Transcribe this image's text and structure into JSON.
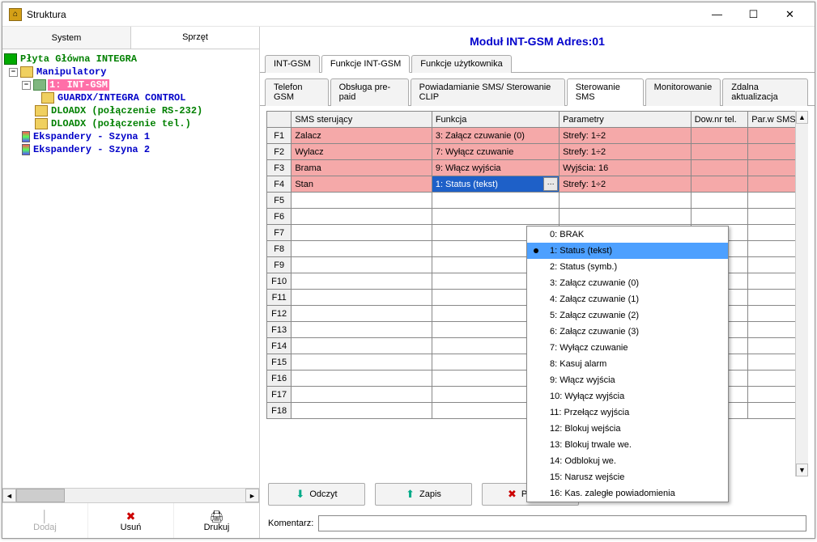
{
  "window": {
    "title": "Struktura"
  },
  "leftTabs": {
    "system": "System",
    "sprzet": "Sprzęt"
  },
  "tree": {
    "root": "Płyta Główna INTEGRA",
    "manip": "Manipulatory",
    "intgsm": "1: INT-GSM",
    "guardx": "GUARDX/INTEGRA CONTROL",
    "dload1": "DLOADX (połączenie RS-232)",
    "dload2": "DLOADX (połączenie tel.)",
    "exp1": "Ekspandery - Szyna 1",
    "exp2": "Ekspandery - Szyna 2"
  },
  "bottomBtns": {
    "dodaj": "Dodaj",
    "usun": "Usuń",
    "drukuj": "Drukuj"
  },
  "module": {
    "title": "Moduł INT-GSM Adres:01"
  },
  "mainTabs": {
    "t1": "INT-GSM",
    "t2": "Funkcje INT-GSM",
    "t3": "Funkcje użytkownika"
  },
  "subTabs": {
    "s1": "Telefon GSM",
    "s2": "Obsługa pre-paid",
    "s3": "Powiadamianie SMS/ Sterowanie CLIP",
    "s4": "Sterowanie SMS",
    "s5": "Monitorowanie",
    "s6": "Zdalna aktualizacja"
  },
  "cols": {
    "c0": "",
    "c1": "SMS sterujący",
    "c2": "Funkcja",
    "c3": "Parametry",
    "c4": "Dow.nr tel.",
    "c5": "Par.w SMS"
  },
  "rows": [
    {
      "id": "F1",
      "sms": "Zalacz",
      "func": "3: Załącz czuwanie (0)",
      "param": "Strefy: 1÷2",
      "pink": true
    },
    {
      "id": "F2",
      "sms": "Wylacz",
      "func": "7: Wyłącz czuwanie",
      "param": "Strefy: 1÷2",
      "pink": true
    },
    {
      "id": "F3",
      "sms": "Brama",
      "func": "9: Włącz wyjścia",
      "param": "Wyjścia: 16",
      "pink": true
    },
    {
      "id": "F4",
      "sms": "Stan",
      "func": "1: Status (tekst)",
      "param": "Strefy: 1÷2",
      "pink": true,
      "sel": true
    },
    {
      "id": "F5"
    },
    {
      "id": "F6"
    },
    {
      "id": "F7"
    },
    {
      "id": "F8"
    },
    {
      "id": "F9"
    },
    {
      "id": "F10"
    },
    {
      "id": "F11"
    },
    {
      "id": "F12"
    },
    {
      "id": "F13"
    },
    {
      "id": "F14"
    },
    {
      "id": "F15"
    },
    {
      "id": "F16"
    },
    {
      "id": "F17"
    },
    {
      "id": "F18"
    }
  ],
  "dropdown": [
    "0: BRAK",
    "1: Status (tekst)",
    "2: Status (symb.)",
    "3: Załącz czuwanie (0)",
    "4: Załącz czuwanie (1)",
    "5: Załącz czuwanie (2)",
    "6: Załącz czuwanie (3)",
    "7: Wyłącz czuwanie",
    "8: Kasuj alarm",
    "9: Włącz wyjścia",
    "10: Wyłącz wyjścia",
    "11: Przełącz wyjścia",
    "12: Blokuj wejścia",
    "13: Blokuj trwale we.",
    "14: Odblokuj we.",
    "15: Narusz wejście",
    "16: Kas. zaległe powiadomienia"
  ],
  "dropdownSelected": 1,
  "actions": {
    "odczyt": "Odczyt",
    "zapis": "Zapis",
    "przerwij": "Przerwij"
  },
  "comment": {
    "label": "Komentarz:",
    "value": ""
  }
}
